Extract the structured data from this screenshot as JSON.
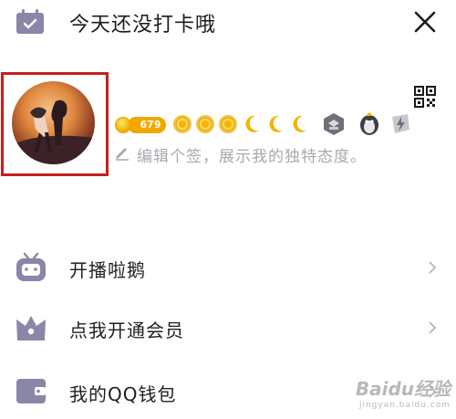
{
  "header": {
    "title": "今天还没打卡哦",
    "left_icon": "calendar-icon",
    "right_icon": "close-icon"
  },
  "profile": {
    "level_number": "679",
    "signature_placeholder": "编辑个签，展示我的独特态度。",
    "qr_icon": "qr-code-icon",
    "badges": [
      "sun-icon",
      "sun-icon",
      "sun-icon",
      "moon-icon",
      "moon-icon",
      "moon-icon",
      "service-badge-icon",
      "penguin-badge-icon",
      "lightning-badge-icon"
    ]
  },
  "menu": {
    "items": [
      {
        "label": "开播啦鹅",
        "icon": "tv-icon"
      },
      {
        "label": "点我开通会员",
        "icon": "crown-icon"
      },
      {
        "label": "我的QQ钱包",
        "icon": "wallet-icon"
      }
    ]
  },
  "watermark": {
    "main": "Baidu经验",
    "sub": "jingyan.baidu.com"
  },
  "colors": {
    "icon_purple": "#8a86a8",
    "highlight_red": "#c81e1e",
    "coin_gold": "#f4b400",
    "placeholder_gray": "#a8a8b0"
  }
}
